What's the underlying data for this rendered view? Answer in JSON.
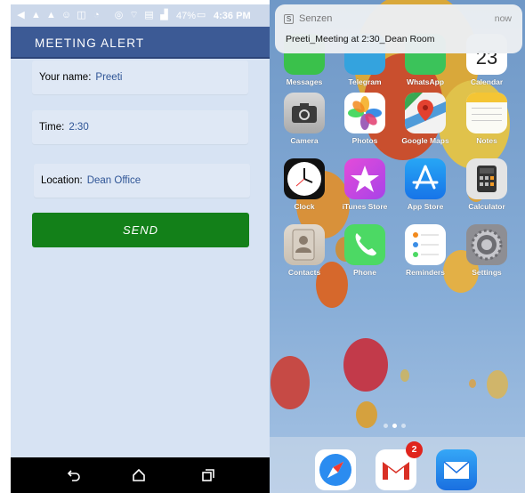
{
  "android": {
    "status_bar": {
      "battery": "47%",
      "time": "4:36 PM"
    },
    "app_bar": {
      "title": "MEETING ALERT"
    },
    "form": {
      "name": {
        "label": "Your name:",
        "value": "Preeti"
      },
      "time": {
        "label": "Time:",
        "value": "2:30"
      },
      "location": {
        "label": "Location:",
        "value": "Dean Office"
      }
    },
    "send_label": "SEND",
    "colors": {
      "app_bar": "#3c5a95",
      "send_button": "#138019",
      "background": "#d7e3f3",
      "value_text": "#2f5596"
    }
  },
  "ios": {
    "notification": {
      "app_icon": "S",
      "app_name": "Senzen",
      "time": "now",
      "message": "Preeti_Meeting at 2:30_Dean Room"
    },
    "apps": [
      {
        "label": "Messages",
        "icon": "messages-icon"
      },
      {
        "label": "Telegram",
        "icon": "telegram-icon"
      },
      {
        "label": "WhatsApp",
        "icon": "whatsapp-icon"
      },
      {
        "label": "Calendar",
        "icon": "calendar-icon"
      },
      {
        "label": "Camera",
        "icon": "camera-icon"
      },
      {
        "label": "Photos",
        "icon": "photos-icon"
      },
      {
        "label": "Google Maps",
        "icon": "google-maps-icon"
      },
      {
        "label": "Notes",
        "icon": "notes-icon"
      },
      {
        "label": "Clock",
        "icon": "clock-icon"
      },
      {
        "label": "iTunes Store",
        "icon": "itunes-star-icon"
      },
      {
        "label": "App Store",
        "icon": "app-store-icon"
      },
      {
        "label": "Calculator",
        "icon": "calculator-icon"
      },
      {
        "label": "Contacts",
        "icon": "contacts-icon"
      },
      {
        "label": "Phone",
        "icon": "phone-icon"
      },
      {
        "label": "Reminders",
        "icon": "reminders-icon"
      },
      {
        "label": "Settings",
        "icon": "settings-gear-icon"
      }
    ],
    "calendar_digits": "23",
    "dock": {
      "apps": [
        {
          "icon": "safari-compass-icon"
        },
        {
          "icon": "gmail-icon"
        },
        {
          "icon": "mail-envelope-icon"
        }
      ],
      "gmail_badge": "2"
    },
    "page_dots": {
      "count": 3,
      "active": 2
    }
  }
}
